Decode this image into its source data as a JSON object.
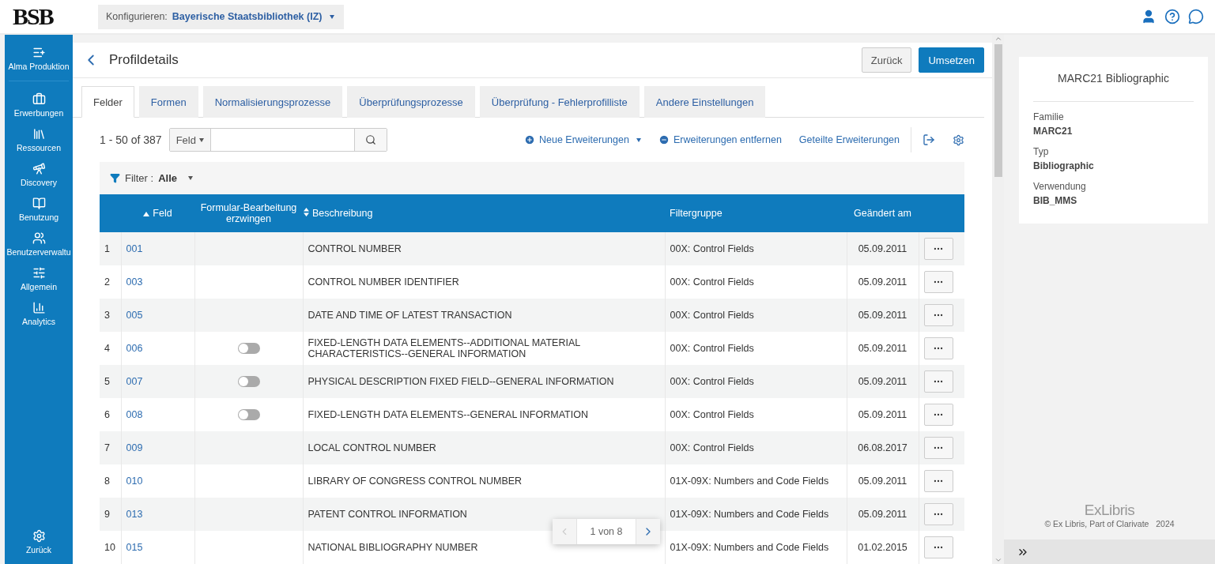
{
  "header": {
    "logo": "BSB",
    "configure_label": "Konfigurieren:",
    "configure_value": "Bayerische Staatsbibliothek (IZ)"
  },
  "sidebar": {
    "items": [
      {
        "label": "Alma Produktion"
      },
      {
        "label": "Erwerbungen"
      },
      {
        "label": "Ressourcen"
      },
      {
        "label": "Discovery"
      },
      {
        "label": "Benutzung"
      },
      {
        "label": "Benutzerverwaltu"
      },
      {
        "label": "Allgemein"
      },
      {
        "label": "Analytics"
      }
    ],
    "bottom": {
      "label": "Zurück"
    }
  },
  "page": {
    "title": "Profildetails",
    "buttons": [
      {
        "label": "Zurück",
        "primary": false
      },
      {
        "label": "Umsetzen",
        "primary": true
      }
    ]
  },
  "tabs": [
    {
      "label": "Felder",
      "selected": true
    },
    {
      "label": "Formen",
      "selected": false
    },
    {
      "label": "Normalisierungsprozesse",
      "selected": false
    },
    {
      "label": "Überprüfungsprozesse",
      "selected": false
    },
    {
      "label": "Überprüfung - Fehlerprofilliste",
      "selected": false
    },
    {
      "label": "Andere Einstellungen",
      "selected": false
    }
  ],
  "toolbar": {
    "count": "1 - 50 of 387",
    "search_scope": "Feld",
    "actions": [
      {
        "kind": "add",
        "label": "Neue Erweiterungen"
      },
      {
        "kind": "remove",
        "label": "Erweiterungen entfernen"
      },
      {
        "kind": "plain",
        "label": "Geteilte Erweiterungen"
      }
    ]
  },
  "filter": {
    "label": "Filter :",
    "value": "Alle"
  },
  "table": {
    "columns": [
      "Feld",
      "Formular-Bearbeitung erzwingen",
      "Beschreibung",
      "Filtergruppe",
      "Geändert am"
    ],
    "rows": [
      {
        "index": "1",
        "field": "001",
        "description": "CONTROL NUMBER",
        "group": "00X: Control Fields",
        "date": "05.09.2011"
      },
      {
        "index": "2",
        "field": "003",
        "description": "CONTROL NUMBER IDENTIFIER",
        "group": "00X: Control Fields",
        "date": "05.09.2011"
      },
      {
        "index": "3",
        "field": "005",
        "description": "DATE AND TIME OF LATEST TRANSACTION",
        "group": "00X: Control Fields",
        "date": "05.09.2011"
      },
      {
        "index": "4",
        "field": "006",
        "toggle": {
          "on": false
        },
        "description": "FIXED-LENGTH DATA ELEMENTS--ADDITIONAL MATERIAL CHARACTERISTICS--GENERAL INFORMATION",
        "group": "00X: Control Fields",
        "date": "05.09.2011"
      },
      {
        "index": "5",
        "field": "007",
        "toggle": {
          "on": false
        },
        "description": "PHYSICAL DESCRIPTION FIXED FIELD--GENERAL INFORMATION",
        "group": "00X: Control Fields",
        "date": "05.09.2011"
      },
      {
        "index": "6",
        "field": "008",
        "toggle": {
          "on": false
        },
        "description": "FIXED-LENGTH DATA ELEMENTS--GENERAL INFORMATION",
        "group": "00X: Control Fields",
        "date": "05.09.2011"
      },
      {
        "index": "7",
        "field": "009",
        "description": "LOCAL CONTROL NUMBER",
        "group": "00X: Control Fields",
        "date": "06.08.2017"
      },
      {
        "index": "8",
        "field": "010",
        "description": "LIBRARY OF CONGRESS CONTROL NUMBER",
        "group": "01X-09X: Numbers and Code Fields",
        "date": "05.09.2011"
      },
      {
        "index": "9",
        "field": "013",
        "description": "PATENT CONTROL INFORMATION",
        "group": "01X-09X: Numbers and Code Fields",
        "date": "05.09.2011"
      },
      {
        "index": "10",
        "field": "015",
        "description": "NATIONAL BIBLIOGRAPHY NUMBER",
        "group": "01X-09X: Numbers and Code Fields",
        "date": "01.02.2015"
      }
    ]
  },
  "pager": {
    "label": "1 von 8",
    "prev_disabled": true
  },
  "info": {
    "title": "MARC21 Bibliographic",
    "fields": [
      {
        "label": "Familie",
        "value": "MARC21"
      },
      {
        "label": "Typ",
        "value": "Bibliographic"
      },
      {
        "label": "Verwendung",
        "value": "BIB_MMS"
      }
    ]
  },
  "footer": {
    "brand": "ExLibris",
    "copyright": "© Ex Libris, Part of Clarivate   2024"
  }
}
